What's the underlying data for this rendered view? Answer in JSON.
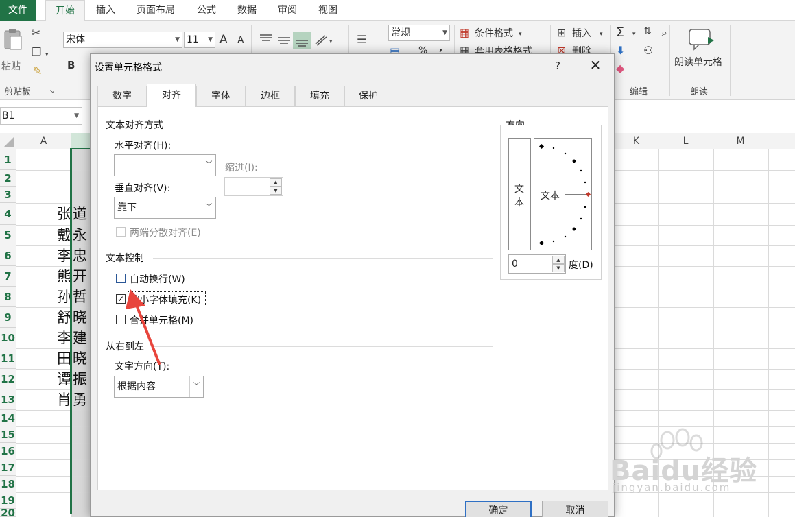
{
  "ribbon": {
    "tabs": [
      "文件",
      "开始",
      "插入",
      "页面布局",
      "公式",
      "数据",
      "审阅",
      "视图"
    ],
    "active_tab": "开始",
    "clipboard": {
      "paste_label": "粘贴",
      "group_label": "剪贴板"
    },
    "font": {
      "name": "宋体",
      "size": "11",
      "grow": "A",
      "shrink": "A",
      "bold": "B"
    },
    "number": {
      "format": "常规",
      "percent": "%",
      "comma": ","
    },
    "styles": {
      "conditional": "条件格式",
      "table": "套用表格格式"
    },
    "cells": {
      "insert": "插入",
      "delete": "删除"
    },
    "editing": {
      "sigma": "Σ",
      "group_label": "编辑"
    },
    "read": {
      "read_cell": "朗读单元格",
      "group_label": "朗读"
    }
  },
  "formula_bar": {
    "name_box": "B1"
  },
  "sheet": {
    "columns": [
      "A",
      "K",
      "L",
      "M"
    ],
    "rows": [
      "1",
      "2",
      "3",
      "4",
      "5",
      "6",
      "7",
      "8",
      "9",
      "10",
      "11",
      "12",
      "13",
      "14",
      "15",
      "16",
      "17",
      "18",
      "19",
      "20"
    ],
    "names": [
      {
        "row": 4,
        "a": "张",
        "b": "道"
      },
      {
        "row": 5,
        "a": "戴",
        "b": "永"
      },
      {
        "row": 6,
        "a": "李",
        "b": "忠"
      },
      {
        "row": 7,
        "a": "熊",
        "b": "开"
      },
      {
        "row": 8,
        "a": "孙",
        "b": "哲"
      },
      {
        "row": 9,
        "a": "舒",
        "b": "晓"
      },
      {
        "row": 10,
        "a": "李",
        "b": "建"
      },
      {
        "row": 11,
        "a": "田",
        "b": "晓"
      },
      {
        "row": 12,
        "a": "谭",
        "b": "振"
      },
      {
        "row": 13,
        "a": "肖",
        "b": "勇"
      }
    ]
  },
  "dialog": {
    "title": "设置单元格格式",
    "help": "?",
    "close": "✕",
    "tabs": [
      "数字",
      "对齐",
      "字体",
      "边框",
      "填充",
      "保护"
    ],
    "active_tab": "对齐",
    "text_alignment": {
      "section": "文本对齐方式",
      "horizontal_label": "水平对齐(H):",
      "horizontal_value": "",
      "vertical_label": "垂直对齐(V):",
      "vertical_value": "靠下",
      "indent_label": "缩进(I):",
      "indent_value": "",
      "justify_distributed": "两端分散对齐(E)"
    },
    "text_control": {
      "section": "文本控制",
      "wrap": {
        "label": "自动换行(W)",
        "checked": false
      },
      "shrink": {
        "label": "缩小字体填充(K)",
        "checked": true
      },
      "merge": {
        "label": "合并单元格(M)",
        "checked": false
      }
    },
    "rtl": {
      "section": "从右到左",
      "direction_label": "文字方向(T):",
      "direction_value": "根据内容"
    },
    "orientation": {
      "section": "方向",
      "vertical_text": "文本",
      "horizontal_text": "文本",
      "degrees_value": "0",
      "degrees_label": "度(D)"
    },
    "buttons": {
      "ok": "确定",
      "cancel": "取消"
    }
  },
  "watermark": {
    "logo": "Baidu经验",
    "url": "jingyan.baidu.com"
  },
  "colors": {
    "excel_green": "#217346",
    "arrow_red": "#e8453c",
    "default_button": "#2f70c4"
  }
}
